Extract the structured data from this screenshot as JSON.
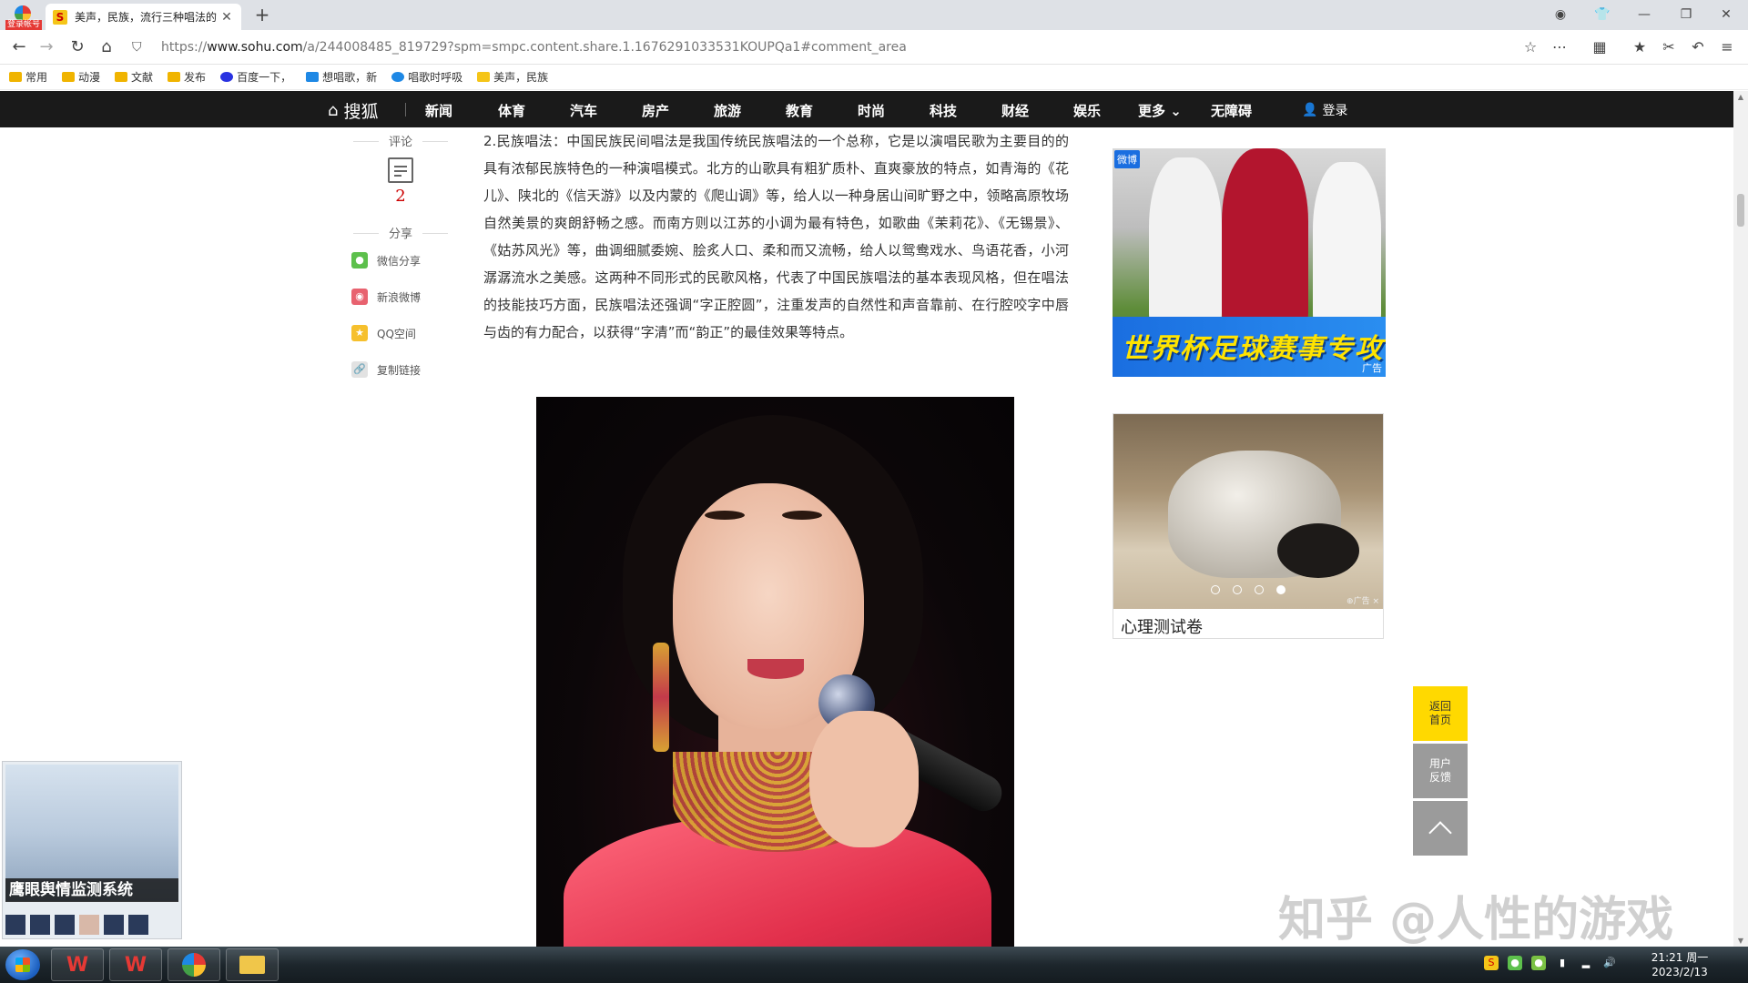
{
  "browser": {
    "logo_tag": "登录帐号",
    "tab_title": "美声，民族，流行三种唱法的",
    "tab_favicon": "S",
    "new_tab": "+",
    "url_prefix": "https://",
    "url_host": "www.sohu.com",
    "url_rest": "/a/244008485_819729?spm=smpc.content.share.1.1676291033531KOUPQa1#comment_area",
    "bookmarks": [
      "常用",
      "动漫",
      "文献",
      "发布",
      "百度一下，",
      "想唱歌，新",
      "唱歌时呼吸",
      "美声，民族"
    ]
  },
  "sohu_nav": {
    "logo": "搜狐",
    "items": [
      "新闻",
      "体育",
      "汽车",
      "房产",
      "旅游",
      "教育",
      "时尚",
      "科技",
      "财经",
      "娱乐",
      "更多",
      "无障碍"
    ],
    "more_suffix": "⌄",
    "login": "登录"
  },
  "left_rail": {
    "comment_label": "评论",
    "comment_count": "2",
    "share_label": "分享",
    "share_items": [
      "微信分享",
      "新浪微博",
      "QQ空间",
      "复制链接"
    ]
  },
  "article": {
    "paragraph": "2.民族唱法：中国民族民间唱法是我国传统民族唱法的一个总称，它是以演唱民歌为主要目的的具有浓郁民族特色的一种演唱模式。北方的山歌具有粗犷质朴、直爽豪放的特点，如青海的《花儿》、陕北的《信天游》以及内蒙的《爬山调》等，给人以一种身居山间旷野之中，领略高原牧场自然美景的爽朗舒畅之感。而南方则以江苏的小调为最有特色，如歌曲《茉莉花》、《无锡景》、《姑苏风光》等，曲调细腻委婉、脍炙人口、柔和而又流畅，给人以鸳鸯戏水、鸟语花香，小河潺潺流水之美感。这两种不同形式的民歌风格，代表了中国民族唱法的基本表现风格，但在唱法的技能技巧方面，民族唱法还强调“字正腔圆”，注重发声的自然性和声音靠前、在行腔咬字中唇与齿的有力配合，以获得“字清”而“韵正”的最佳效果等特点。"
  },
  "ads": {
    "ad1_corner": "微博",
    "ad1_banner": "世界杯足球赛事专攻",
    "ad1_tag": "广告",
    "ad2_tag": "⊕广告 ×",
    "ad2_caption": "心理测试卷",
    "ad2_dots_active": 3
  },
  "float_buttons": {
    "home": "返回首页",
    "feedback": "用户反馈"
  },
  "popup": {
    "title": "鹰眼舆情监测系统"
  },
  "watermark": "知乎 @人性的游戏",
  "taskbar": {
    "time": "21:21 周一",
    "date": "2023/2/13"
  },
  "colors": {
    "nav_bg": "#1a1a1a",
    "accent_yellow": "#ffd900",
    "comment_red": "#cc0000"
  }
}
